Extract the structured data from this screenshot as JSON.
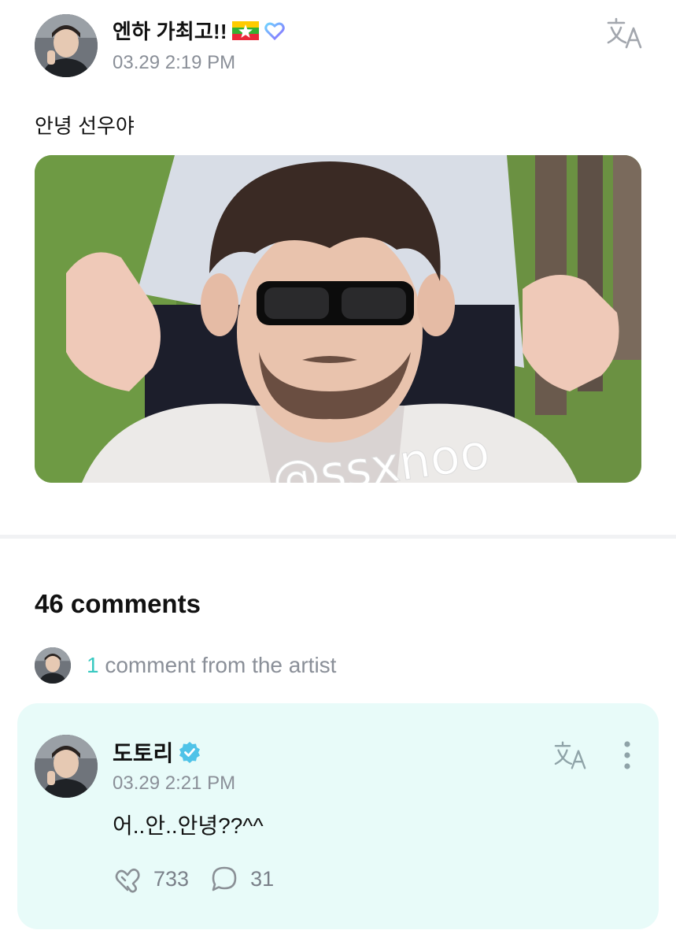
{
  "post": {
    "author_name": "엔하 가최고!!",
    "time": "03.29 2:19 PM",
    "text": "안녕 선우야",
    "image_watermark": "@ssxnoo"
  },
  "comments": {
    "count_label": "46 comments",
    "artist_count": "1",
    "artist_label": "comment from the artist"
  },
  "artist_comment": {
    "author_name": "도토리",
    "time": "03.29 2:21 PM",
    "text": "어..안..안녕??^^",
    "likes": "733",
    "replies": "31"
  },
  "icons": {
    "translate": "translate-icon",
    "more": "more-vertical-icon",
    "like": "heart-hands-icon",
    "reply": "speech-bubble-icon",
    "verified": "verified-badge-icon",
    "flag": "myanmar-flag-icon",
    "badge": "heart-badge-icon"
  },
  "colors": {
    "accent": "#38c9c1",
    "artist_bg": "#e8fbf9",
    "muted": "#8a8f98"
  }
}
